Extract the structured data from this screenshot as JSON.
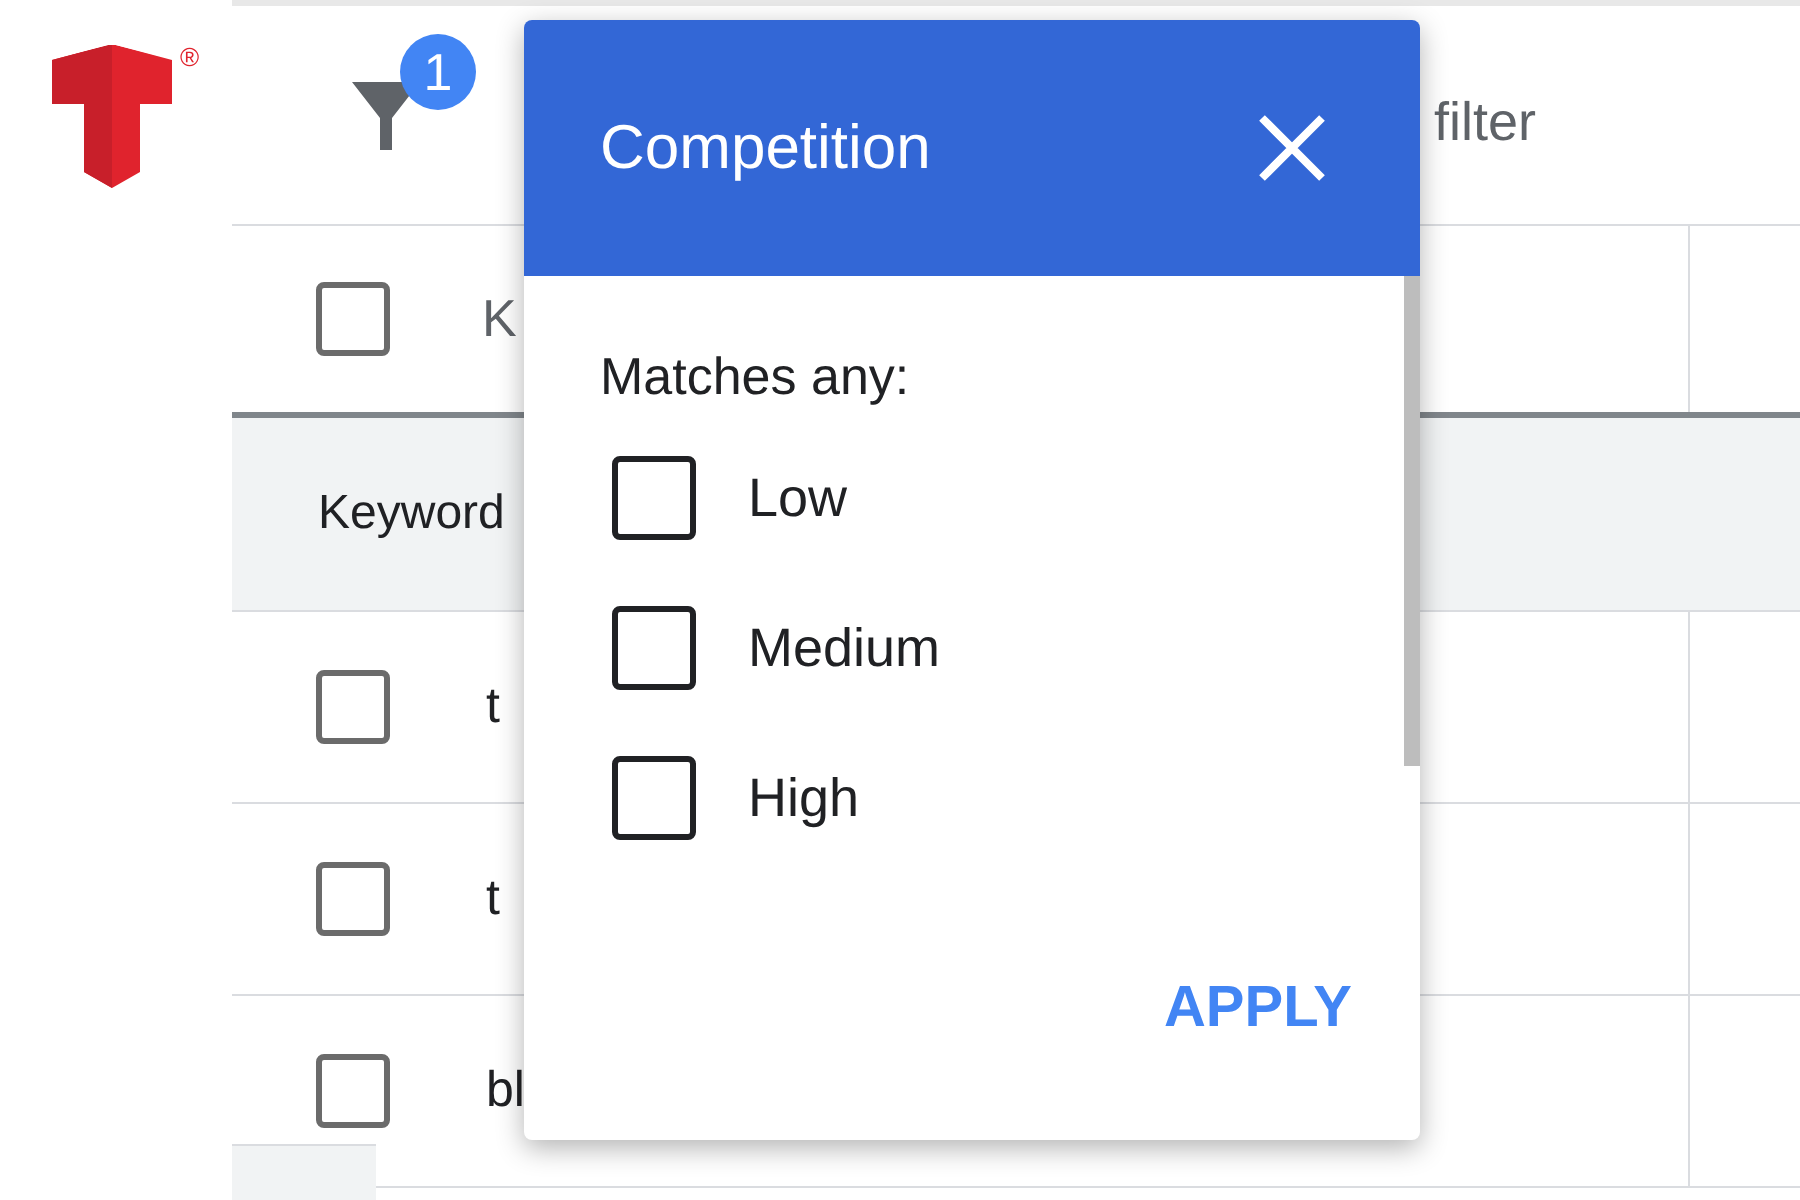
{
  "logo": {
    "registered_mark": "®"
  },
  "toolbar": {
    "filter_badge": "1",
    "filter_label": "filter"
  },
  "table": {
    "header": {
      "checked": false,
      "column_1": "K"
    },
    "group_row": {
      "label": "Keyword"
    },
    "rows": [
      {
        "checked": false,
        "column_1": "t"
      },
      {
        "checked": false,
        "column_1": "t"
      },
      {
        "checked": false,
        "column_1": "bl"
      }
    ]
  },
  "popup": {
    "title": "Competition",
    "subtitle": "Matches any:",
    "options": [
      {
        "label": "Low",
        "checked": false
      },
      {
        "label": "Medium",
        "checked": false
      },
      {
        "label": "High",
        "checked": false
      }
    ],
    "apply": "APPLY"
  }
}
